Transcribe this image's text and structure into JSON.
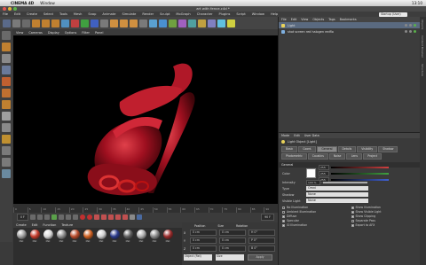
{
  "system_menu": {
    "apple": "",
    "app_name": "CINEMA 4D",
    "window_menu": "Window",
    "clock": "13:10"
  },
  "window_title": "art with fence.c4d *",
  "menu": [
    "File",
    "Edit",
    "Create",
    "Select",
    "Tools",
    "Mesh",
    "Snap",
    "Animate",
    "Simulate",
    "Render",
    "Sculpt",
    "MoGraph",
    "Character",
    "Plugins",
    "Script",
    "Window",
    "Help"
  ],
  "layout_label": "Startup (User)",
  "viewport_menu": [
    "View",
    "Cameras",
    "Display",
    "Options",
    "Filter",
    "Panel"
  ],
  "timeline": {
    "ticks": [
      "0",
      "5",
      "10",
      "15",
      "20",
      "25",
      "30",
      "35",
      "40",
      "45",
      "50",
      "55",
      "60",
      "65",
      "70",
      "75",
      "80",
      "85",
      "90"
    ],
    "start_frame": "0 F",
    "end_frame": "90 F"
  },
  "material_menu": [
    "Create",
    "Edit",
    "Function",
    "Texture"
  ],
  "materials": [
    {
      "label": "Mat",
      "color": "#a0a0a0"
    },
    {
      "label": "Mat",
      "color": "#c43a2a"
    },
    {
      "label": "Mat",
      "color": "#d8d8d8"
    },
    {
      "label": "Mat",
      "color": "#909090"
    },
    {
      "label": "Mat",
      "color": "#b84a2a"
    },
    {
      "label": "Mat",
      "color": "#d06020"
    },
    {
      "label": "Mat",
      "color": "#cfcfcf"
    },
    {
      "label": "Mat",
      "color": "#2a3a8a"
    },
    {
      "label": "Mat",
      "color": "#606060"
    },
    {
      "label": "Mat",
      "color": "#b0b0b0"
    },
    {
      "label": "Mat",
      "color": "#888888"
    },
    {
      "label": "Mat",
      "color": "#9a2a2a"
    }
  ],
  "coords": {
    "headers": [
      "Position",
      "Size",
      "Rotation"
    ],
    "rows": [
      {
        "axis": "X",
        "pos": "0 cm",
        "size": "0 cm",
        "rot": "H 0°"
      },
      {
        "axis": "Y",
        "pos": "0 cm",
        "size": "0 cm",
        "rot": "P 0°"
      },
      {
        "axis": "Z",
        "pos": "0 cm",
        "size": "0 cm",
        "rot": "B 0°"
      }
    ],
    "mode_select": "Object (Rel)",
    "size_select": "Size",
    "apply": "Apply"
  },
  "object_manager": {
    "menu": [
      "File",
      "Edit",
      "View",
      "Objects",
      "Tags",
      "Bookmarks"
    ],
    "objects": [
      {
        "name": "Light",
        "icon_color": "#e8d25a",
        "selected": true
      },
      {
        "name": "shot screen red halogen redflo",
        "icon_color": "#7fb0e0",
        "selected": false
      }
    ]
  },
  "attributes": {
    "menu": [
      "Mode",
      "Edit",
      "User Data"
    ],
    "title": "Light Object [Light]",
    "tabs": [
      {
        "label": "Basic",
        "on": false
      },
      {
        "label": "Coord.",
        "on": false
      },
      {
        "label": "General",
        "on": true
      },
      {
        "label": "Details",
        "on": false
      },
      {
        "label": "Visibility",
        "on": false
      },
      {
        "label": "Shadow",
        "on": false
      },
      {
        "label": "Photometric",
        "on": false
      },
      {
        "label": "Caustics",
        "on": false
      },
      {
        "label": "Noise",
        "on": false
      },
      {
        "label": "Lens",
        "on": false
      },
      {
        "label": "Project",
        "on": false
      }
    ],
    "section": "General",
    "color_label": "Color",
    "rgb": [
      {
        "value": "255",
        "color": "#d04040"
      },
      {
        "value": "255",
        "color": "#40a040"
      },
      {
        "value": "255",
        "color": "#4060d0"
      }
    ],
    "intensity_label": "Intensity",
    "intensity_value": "100 %",
    "type_label": "Type",
    "type_value": "Omni",
    "shadow_label": "Shadow",
    "shadow_value": "None",
    "visible_label": "Visible Light",
    "visible_value": "None",
    "checks": [
      {
        "label": "No Illumination",
        "on": false
      },
      {
        "label": "Show Illumination",
        "on": true
      },
      {
        "label": "Ambient Illumination",
        "on": false
      },
      {
        "label": "Show Visible Light",
        "on": true
      },
      {
        "label": "Diffuse",
        "on": true
      },
      {
        "label": "Show Clipping",
        "on": true
      },
      {
        "label": "Specular",
        "on": true
      },
      {
        "label": "Separate Pass",
        "on": false
      },
      {
        "label": "GI Illumination",
        "on": true
      },
      {
        "label": "Export to AFX",
        "on": true
      }
    ]
  },
  "side_tabs": [
    "Objects",
    "Content Browser",
    "Structure"
  ]
}
